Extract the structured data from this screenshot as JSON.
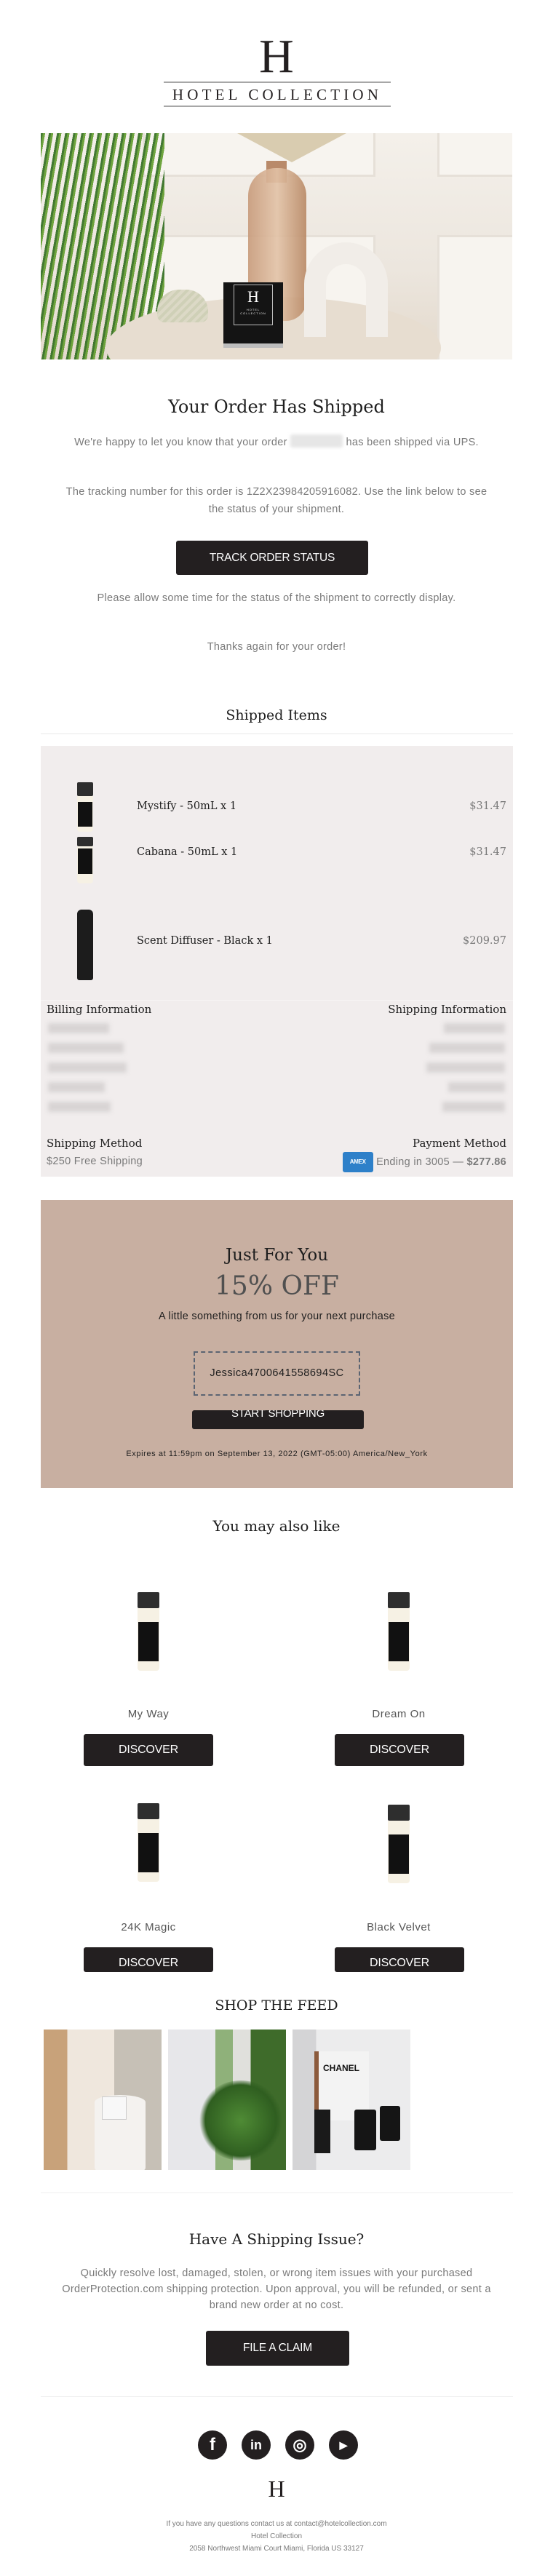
{
  "brand": {
    "logo_letter": "H",
    "logo_text": "HOTEL COLLECTION"
  },
  "hero": {
    "image_alt": "Hotel Collection candle on marble side table with vase and plant",
    "candle_label": "H",
    "candle_sub": "HOTEL COLLECTION"
  },
  "shipped": {
    "title": "Your Order Has Shipped",
    "intro_before": "We're happy to let you know that your order",
    "intro_after": "has been shipped via UPS.",
    "tracking_text": "The tracking number for this order is 1Z2X23984205916082. Use the link below to see the status of your shipment.",
    "track_button": "TRACK ORDER STATUS",
    "allow_time_text": "Please allow some time for the status of the shipment to correctly display.",
    "thanks_text": "Thanks again for your order!"
  },
  "items_section": {
    "title": "Shipped Items",
    "items": [
      {
        "name": "Mystify - 50mL x 1",
        "price": "$31.47",
        "image": "fragrance-oil-bottle"
      },
      {
        "name": "Cabana - 50mL x 1",
        "price": "$31.47",
        "image": "fragrance-oil-bottle"
      },
      {
        "name": "Scent Diffuser - Black x 1",
        "price": "$209.97",
        "image": "scent-diffuser-black"
      }
    ],
    "billing_label": "Billing Information",
    "shipping_label": "Shipping Information",
    "shipping_method_label": "Shipping Method",
    "shipping_method_value": "$250 Free Shipping",
    "payment_method_label": "Payment Method",
    "payment_card_brand": "AMEX",
    "payment_card_text": "Ending in 3005 —",
    "payment_total": "$277.86"
  },
  "coupon": {
    "title": "Just For You",
    "discount": "15% OFF",
    "subtitle": "A little something from us for your next purchase",
    "code": "Jessica4700641558694SC",
    "button": "START SHOPPING",
    "expires": "Expires at 11:59pm on September 13, 2022 (GMT-05:00) America/New_York"
  },
  "recommendations": {
    "title": "You may also like",
    "products": [
      {
        "name": "My Way",
        "button": "DISCOVER"
      },
      {
        "name": "Dream On",
        "button": "DISCOVER"
      },
      {
        "name": "24K Magic",
        "button": "DISCOVER"
      },
      {
        "name": "Black Velvet",
        "button": "DISCOVER"
      }
    ]
  },
  "feed": {
    "title": "SHOP THE FEED",
    "images": [
      "feed-image-candle-side-table",
      "feed-image-palm-lobby",
      "feed-image-chanel-candles"
    ],
    "chanel_text": "CHANEL"
  },
  "claim": {
    "title": "Have A Shipping Issue?",
    "text": "Quickly resolve lost, damaged, stolen, or wrong item issues with your purchased OrderProtection.com shipping protection. Upon approval, you will be refunded, or sent a brand new order at no cost.",
    "button": "FILE A CLAIM"
  },
  "footer": {
    "social": [
      {
        "name": "facebook",
        "glyph": "f"
      },
      {
        "name": "linkedin",
        "glyph": "in"
      },
      {
        "name": "instagram",
        "glyph": "◎"
      },
      {
        "name": "youtube",
        "glyph": "▶"
      }
    ],
    "logo_letter": "H",
    "contact_text": "If you have any questions contact us at contact@hotelcollection.com",
    "company": "Hotel Collection",
    "address": "2058 Northwest Miami Court Miami, Florida US 33127"
  }
}
